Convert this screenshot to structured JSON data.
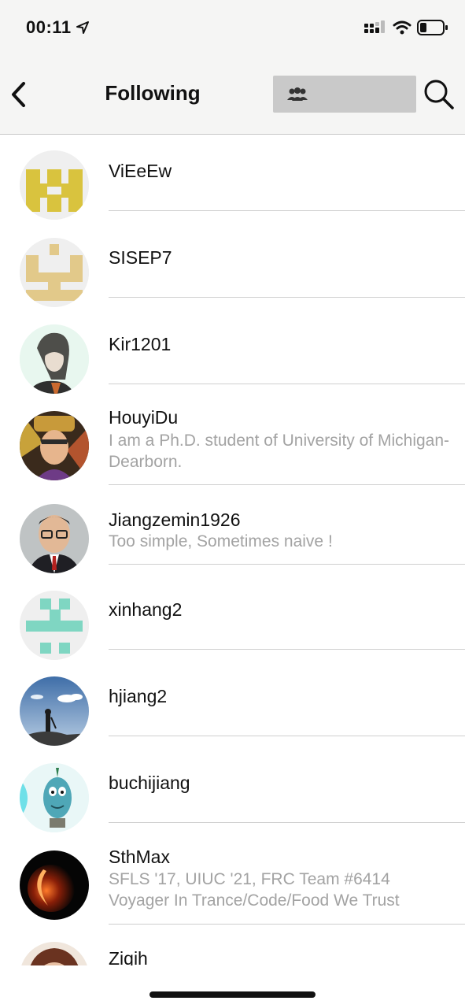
{
  "status_bar": {
    "time": "00:11",
    "icons": [
      "location-arrow-icon",
      "cellular-signal-icon",
      "wifi-icon",
      "battery-icon"
    ]
  },
  "nav": {
    "title": "Following",
    "back_icon": "chevron-left-icon",
    "search_field_icon": "group-icon",
    "search_icon": "search-icon"
  },
  "users": [
    {
      "username": "ViEeEw",
      "bio": ""
    },
    {
      "username": "SISEP7",
      "bio": ""
    },
    {
      "username": "Kir1201",
      "bio": ""
    },
    {
      "username": "HouyiDu",
      "bio": "I am a Ph.D. student of University of Michigan-Dearborn."
    },
    {
      "username": "Jiangzemin1926",
      "bio": "Too simple, Sometimes naive !"
    },
    {
      "username": "xinhang2",
      "bio": ""
    },
    {
      "username": "hjiang2",
      "bio": ""
    },
    {
      "username": "buchijiang",
      "bio": ""
    },
    {
      "username": "SthMax",
      "bio": "SFLS '17, UIUC '21, FRC Team #6414 Voyager In Trance/Code/Food We Trust"
    },
    {
      "username": "Ziqih",
      "bio": ""
    }
  ],
  "colors": {
    "header_bg": "#f5f5f4",
    "search_field_bg": "#c9c9c9",
    "bio_text": "#a3a3a3",
    "identicon_yellow": "#d9c33e",
    "identicon_tan": "#e2c98a",
    "identicon_teal": "#7fd6c2"
  }
}
